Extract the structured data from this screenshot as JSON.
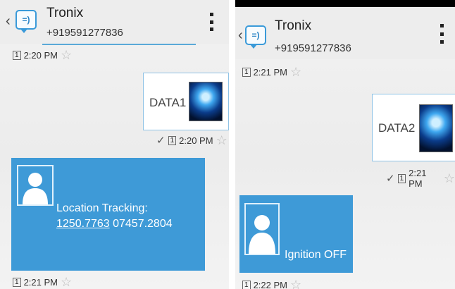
{
  "left": {
    "contact": {
      "name": "Tronix",
      "number": "+919591277836"
    },
    "stamps": {
      "t1": "2:20 PM",
      "t2": "2:20 PM",
      "t3": "2:21 PM"
    },
    "sim_label": "1",
    "outgoing": {
      "text": "DATA1"
    },
    "incoming": {
      "line1": "Location Tracking:",
      "coord1": "1250.7763",
      "coord2": "07457.2804"
    }
  },
  "right": {
    "contact": {
      "name": "Tronix",
      "number": "+919591277836"
    },
    "stamps": {
      "t1": "2:21 PM",
      "t2": "2:21 PM",
      "t3": "2:22 PM"
    },
    "sim_label": "1",
    "outgoing": {
      "text": "DATA2"
    },
    "incoming": {
      "line1": "Ignition OFF"
    }
  },
  "icons": [
    "back-chevron-icon",
    "messaging-app-icon",
    "overflow-menu-icon",
    "star-icon",
    "sent-check-icon",
    "contact-avatar-icon"
  ],
  "colors": {
    "accent": "#3e9ad7",
    "bubble_border": "#8fc3e6",
    "header_bg": "#ededed"
  }
}
